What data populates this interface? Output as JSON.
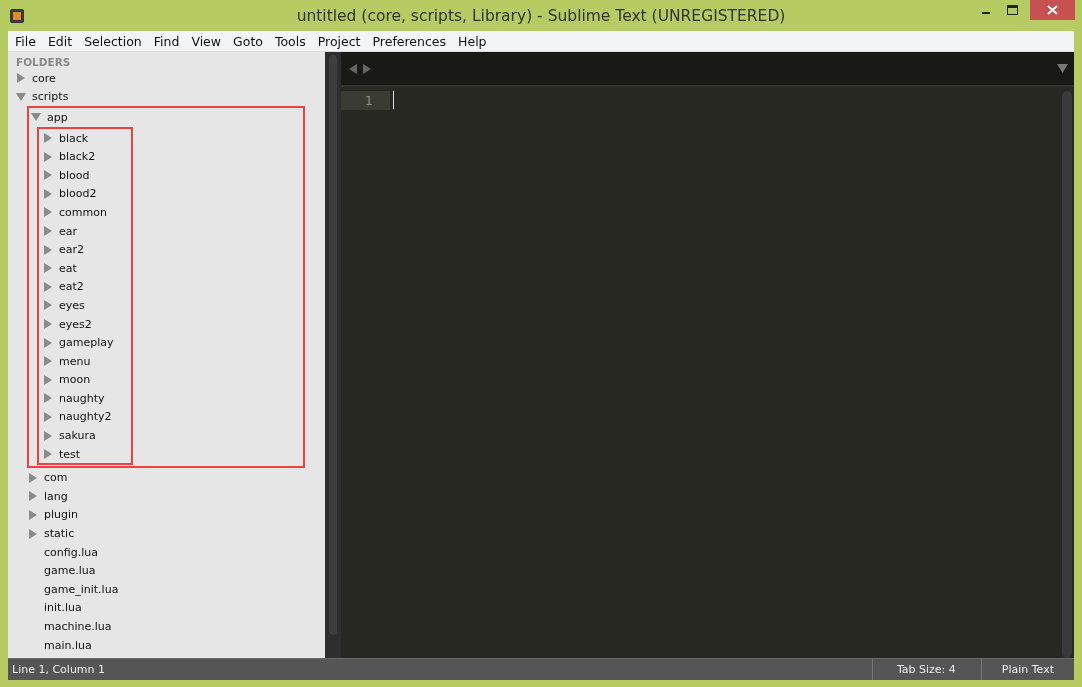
{
  "window": {
    "title": "untitled (core, scripts, Library) - Sublime Text (UNREGISTERED)"
  },
  "menu": [
    "File",
    "Edit",
    "Selection",
    "Find",
    "View",
    "Goto",
    "Tools",
    "Project",
    "Preferences",
    "Help"
  ],
  "sidebar": {
    "heading": "FOLDERS",
    "items": [
      {
        "kind": "folder",
        "label": "core",
        "expanded": false
      },
      {
        "kind": "folder",
        "label": "scripts",
        "expanded": true,
        "children": [
          {
            "kind": "folder",
            "label": "app",
            "expanded": true,
            "highlighted": true,
            "children": [
              {
                "kind": "folder",
                "label": "black",
                "expanded": false
              },
              {
                "kind": "folder",
                "label": "black2",
                "expanded": false
              },
              {
                "kind": "folder",
                "label": "blood",
                "expanded": false
              },
              {
                "kind": "folder",
                "label": "blood2",
                "expanded": false
              },
              {
                "kind": "folder",
                "label": "common",
                "expanded": false
              },
              {
                "kind": "folder",
                "label": "ear",
                "expanded": false
              },
              {
                "kind": "folder",
                "label": "ear2",
                "expanded": false
              },
              {
                "kind": "folder",
                "label": "eat",
                "expanded": false
              },
              {
                "kind": "folder",
                "label": "eat2",
                "expanded": false
              },
              {
                "kind": "folder",
                "label": "eyes",
                "expanded": false
              },
              {
                "kind": "folder",
                "label": "eyes2",
                "expanded": false
              },
              {
                "kind": "folder",
                "label": "gameplay",
                "expanded": false
              },
              {
                "kind": "folder",
                "label": "menu",
                "expanded": false
              },
              {
                "kind": "folder",
                "label": "moon",
                "expanded": false
              },
              {
                "kind": "folder",
                "label": "naughty",
                "expanded": false
              },
              {
                "kind": "folder",
                "label": "naughty2",
                "expanded": false
              },
              {
                "kind": "folder",
                "label": "sakura",
                "expanded": false
              },
              {
                "kind": "folder",
                "label": "test",
                "expanded": false
              }
            ]
          },
          {
            "kind": "folder",
            "label": "com",
            "expanded": false
          },
          {
            "kind": "folder",
            "label": "lang",
            "expanded": false
          },
          {
            "kind": "folder",
            "label": "plugin",
            "expanded": false
          },
          {
            "kind": "folder",
            "label": "static",
            "expanded": false
          },
          {
            "kind": "file",
            "label": "config.lua"
          },
          {
            "kind": "file",
            "label": "game.lua"
          },
          {
            "kind": "file",
            "label": "game_init.lua"
          },
          {
            "kind": "file",
            "label": "init.lua"
          },
          {
            "kind": "file",
            "label": "machine.lua"
          },
          {
            "kind": "file",
            "label": "main.lua"
          }
        ]
      }
    ]
  },
  "editor": {
    "line_numbers": [
      "1"
    ]
  },
  "status_bar": {
    "position": "Line 1, Column 1",
    "tab_size": "Tab Size: 4",
    "syntax": "Plain Text"
  }
}
